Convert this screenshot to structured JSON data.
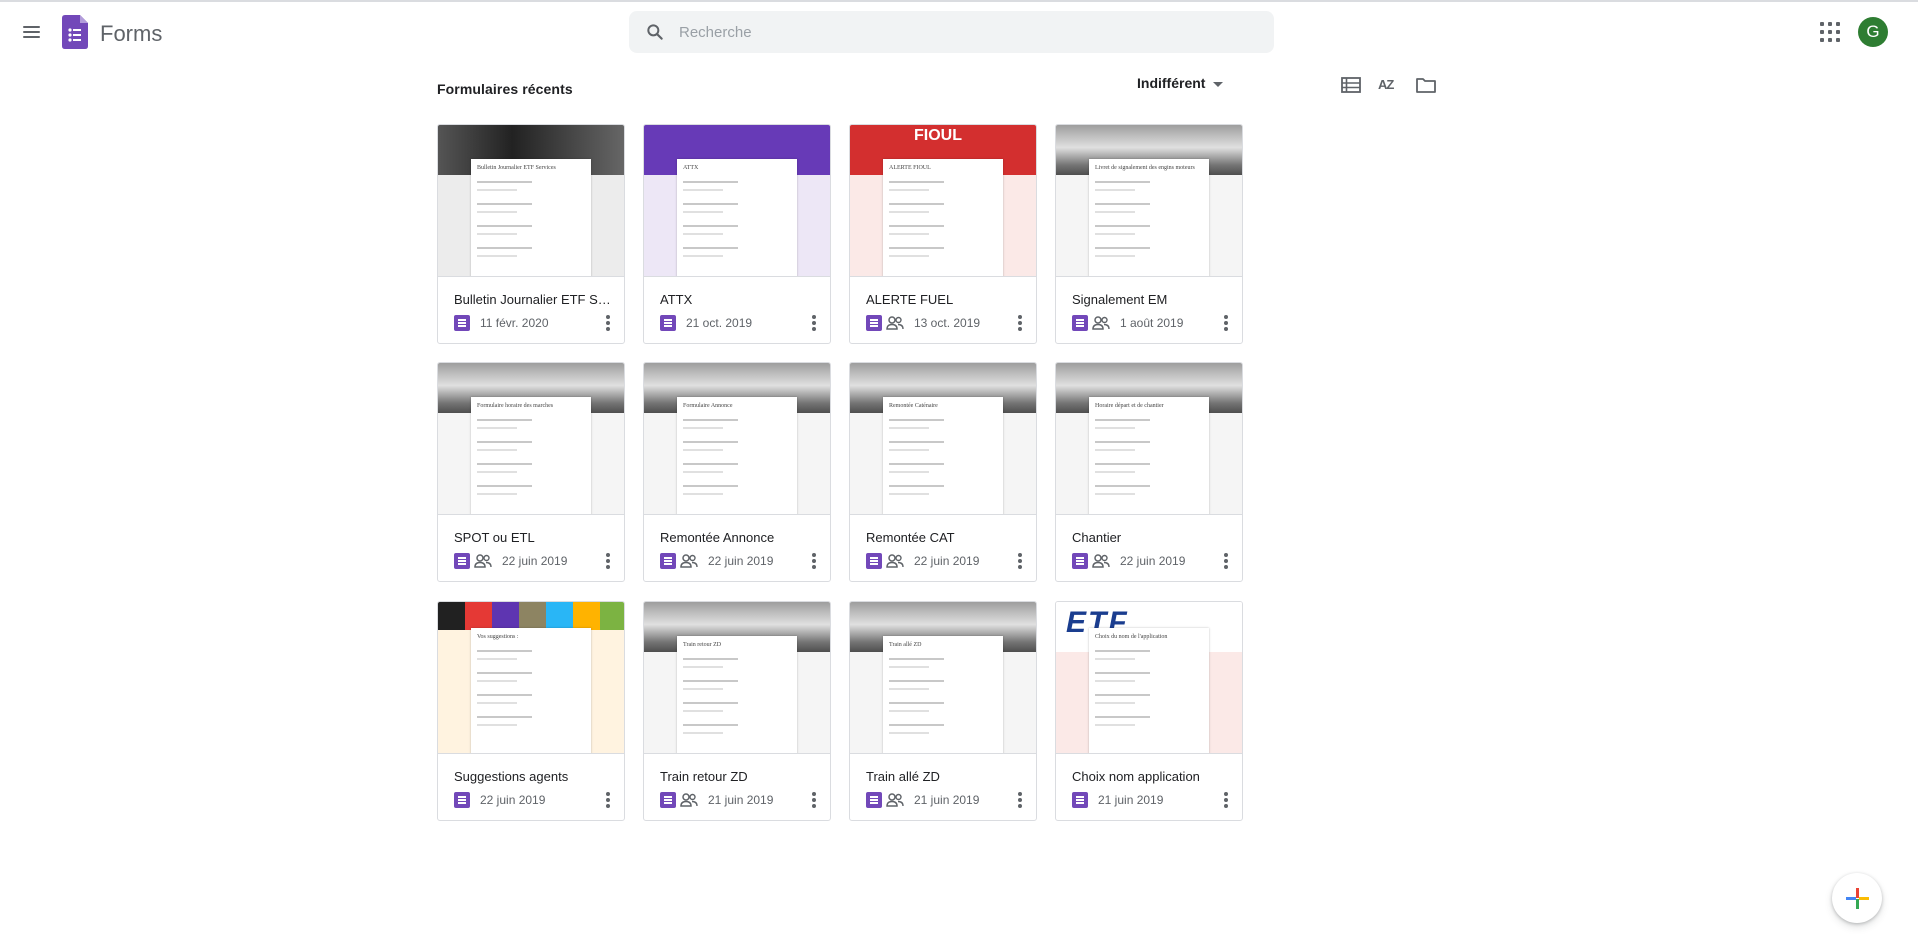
{
  "header": {
    "app_name": "Forms",
    "search_placeholder": "Recherche",
    "avatar_initial": "G"
  },
  "toolbar": {
    "section_title": "Formulaires récents",
    "owner_filter": "Indifférent",
    "sort_label": "AZ"
  },
  "colors": {
    "forms_purple": "#7248b9",
    "avatar_green": "#2e7d32"
  },
  "forms": [
    {
      "title": "Bulletin Journalier ETF Services",
      "date": "11 févr. 2020",
      "shared": false,
      "thumb_title": "Bulletin Journalier ETF Services",
      "theme": "dark"
    },
    {
      "title": "ATTX",
      "date": "21 oct. 2019",
      "shared": false,
      "thumb_title": "ATTX",
      "theme": "purple"
    },
    {
      "title": "ALERTE FUEL",
      "date": "13 oct. 2019",
      "shared": true,
      "thumb_title": "ALERTE FIOUL",
      "theme": "red",
      "banner_text": "FIOUL"
    },
    {
      "title": "Signalement EM",
      "date": "1 août 2019",
      "shared": true,
      "thumb_title": "Livret de signalement des engins moteurs",
      "theme": "train"
    },
    {
      "title": "SPOT ou ETL",
      "date": "22 juin 2019",
      "shared": true,
      "thumb_title": "Formulaire horaire des marches",
      "theme": "train"
    },
    {
      "title": "Remontée Annonce",
      "date": "22 juin 2019",
      "shared": true,
      "thumb_title": "Formulaire Annonce",
      "theme": "train"
    },
    {
      "title": "Remontée CAT",
      "date": "22 juin 2019",
      "shared": true,
      "thumb_title": "Remontée Caténaire",
      "theme": "train"
    },
    {
      "title": "Chantier",
      "date": "22 juin 2019",
      "shared": true,
      "thumb_title": "Horaire départ et de chantier",
      "theme": "train"
    },
    {
      "title": "Suggestions agents",
      "date": "22 juin 2019",
      "shared": false,
      "thumb_title": "Vos suggestions :",
      "theme": "bulbs"
    },
    {
      "title": "Train retour ZD",
      "date": "21 juin 2019",
      "shared": true,
      "thumb_title": "Train retour ZD",
      "theme": "train"
    },
    {
      "title": "Train allé ZD",
      "date": "21 juin 2019",
      "shared": true,
      "thumb_title": "Train allé ZD",
      "theme": "train"
    },
    {
      "title": "Choix nom application",
      "date": "21 juin 2019",
      "shared": false,
      "thumb_title": "Choix du nom de l'application",
      "theme": "etf",
      "banner_text": "ETF"
    }
  ]
}
